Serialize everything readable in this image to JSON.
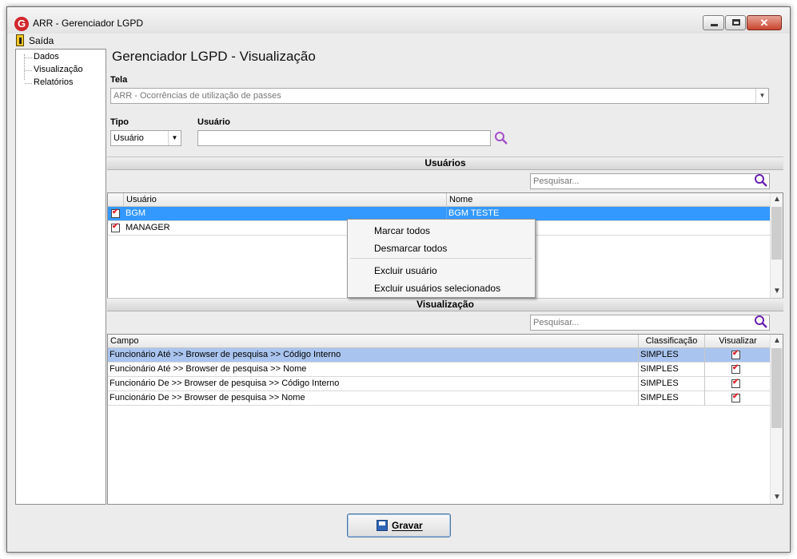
{
  "window": {
    "title": "ARR - Gerenciador LGPD",
    "app_icon_letter": "G"
  },
  "menu": {
    "exit_label": "Saída"
  },
  "sidebar": {
    "items": [
      {
        "label": "Dados"
      },
      {
        "label": "Visualização"
      },
      {
        "label": "Relatórios"
      }
    ]
  },
  "page": {
    "title": "Gerenciador LGPD - Visualização"
  },
  "tela": {
    "label": "Tela",
    "value": "ARR - Ocorrências de utilização de passes"
  },
  "tipo": {
    "label": "Tipo",
    "value": "Usuário"
  },
  "usuario": {
    "label": "Usuário",
    "value": ""
  },
  "users_section": {
    "title": "Usuários",
    "search_placeholder": "Pesquisar...",
    "columns": [
      "Usuário",
      "Nome"
    ],
    "rows": [
      {
        "checked": true,
        "user": "BGM",
        "name": "BGM TESTE",
        "selected": true
      },
      {
        "checked": true,
        "user": "MANAGER",
        "name": "",
        "selected": false
      }
    ]
  },
  "context_menu": {
    "items": [
      "Marcar todos",
      "Desmarcar todos",
      "Excluir usuário",
      "Excluir usuários selecionados"
    ]
  },
  "view_section": {
    "title": "Visualização",
    "search_placeholder": "Pesquisar...",
    "columns": [
      "Campo",
      "Classificação",
      "Visualizar"
    ],
    "rows": [
      {
        "campo": "Funcionário Até >> Browser de pesquisa >> Código Interno",
        "classificacao": "SIMPLES",
        "visualizar": true,
        "selected": true
      },
      {
        "campo": "Funcionário Até >> Browser de pesquisa >> Nome",
        "classificacao": "SIMPLES",
        "visualizar": true,
        "selected": false
      },
      {
        "campo": "Funcionário De >> Browser de pesquisa >> Código Interno",
        "classificacao": "SIMPLES",
        "visualizar": true,
        "selected": false
      },
      {
        "campo": "Funcionário De >> Browser de pesquisa >> Nome",
        "classificacao": "SIMPLES",
        "visualizar": true,
        "selected": false
      }
    ]
  },
  "footer": {
    "save_label": "Gravar"
  },
  "colors": {
    "selection": "#3399ff",
    "selection_light": "#a9c4ee",
    "check": "#e0202a"
  }
}
